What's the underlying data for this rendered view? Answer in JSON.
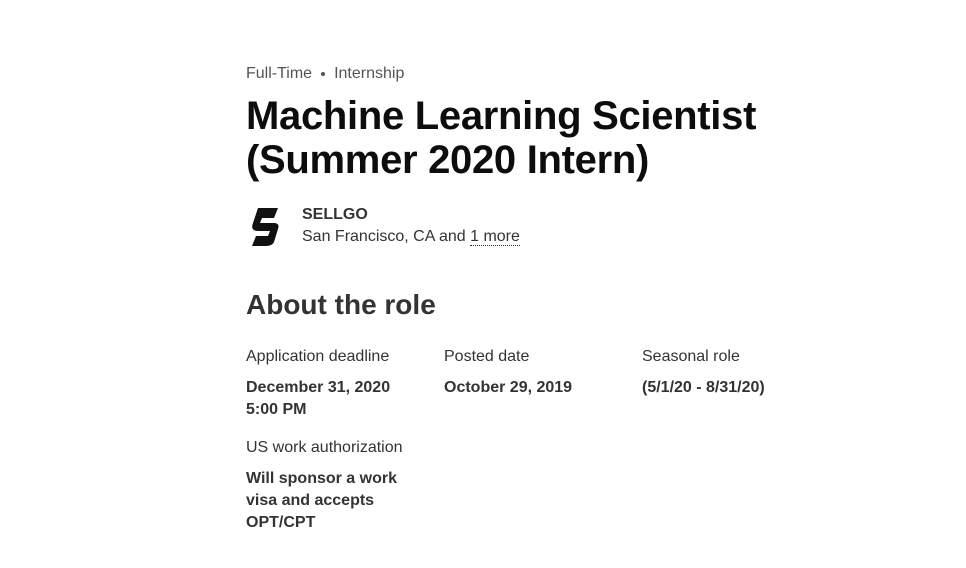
{
  "job": {
    "tags": [
      "Full-Time",
      "Internship"
    ],
    "title_line1": "Machine Learning Scientist",
    "title_line2": "(Summer 2020 Intern)"
  },
  "employer": {
    "name": "SELLGO",
    "location": "San Francisco, CA and ",
    "more_link": "1 more",
    "logo_icon": "sellgo-logo"
  },
  "about": {
    "heading": "About the role",
    "fields": [
      {
        "label": "Application deadline",
        "value": "December 31, 2020 5:00 PM"
      },
      {
        "label": "Posted date",
        "value": "October 29, 2019"
      },
      {
        "label": "Seasonal role",
        "value": "(5/1/20 - 8/31/20)"
      },
      {
        "label": "US work authorization",
        "value": "Will sponsor a work visa and accepts OPT/CPT"
      }
    ]
  }
}
